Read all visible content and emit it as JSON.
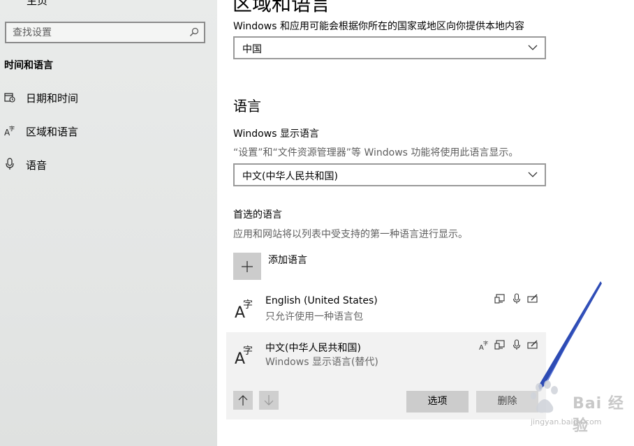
{
  "sidebar": {
    "home_label": "主页",
    "search_placeholder": "查找设置",
    "section_title": "时间和语言",
    "items": [
      {
        "label": "日期和时间",
        "icon": "calendar-clock-icon"
      },
      {
        "label": "区域和语言",
        "icon": "language-icon"
      },
      {
        "label": "语音",
        "icon": "microphone-icon"
      }
    ]
  },
  "main": {
    "title": "区域和语言",
    "region_desc": "Windows 和应用可能会根据你所在的国家或地区向你提供本地内容",
    "region_value": "中国",
    "language_heading": "语言",
    "display_lang_label": "Windows 显示语言",
    "display_lang_desc": "“设置”和“文件资源管理器”等 Windows 功能将使用此语言显示。",
    "display_lang_value": "中文(中华人民共和国)",
    "preferred_label": "首选的语言",
    "preferred_desc": "应用和网站将以列表中受支持的第一种语言进行显示。",
    "add_label": "添加语言",
    "languages": [
      {
        "name": "English (United States)",
        "sub": "只允许使用一种语言包"
      },
      {
        "name": "中文(中华人民共和国)",
        "sub": "Windows 显示语言(替代)"
      }
    ],
    "options_button": "选项",
    "remove_button": "删除"
  },
  "watermark": {
    "text": "Bai 经验",
    "url": "jingyan.baidu.com"
  },
  "colors": {
    "sidebar_bg": "#e6e8e7",
    "button_bg": "#cccccc",
    "selected_bg": "#f2f2f2",
    "pointer": "#2d4bb4"
  }
}
